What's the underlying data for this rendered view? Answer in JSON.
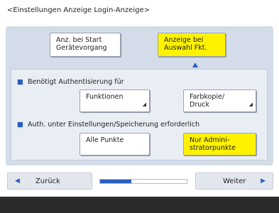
{
  "header": {
    "title": "<Einstellungen Anzeige Login-Anzeige>"
  },
  "mode_buttons": {
    "start": {
      "line1": "Anz. bei Start",
      "line2": "Gerätevorgang"
    },
    "select": {
      "line1": "Anzeige bei",
      "line2": "Auswahl Fkt."
    }
  },
  "auth_section": {
    "label": "Benötigt Authentisierung für",
    "functions": {
      "line1": "Funktionen"
    },
    "colorcopy": {
      "line1": "Farbkopie/",
      "line2": "Druck"
    }
  },
  "settings_section": {
    "label": "Auth. unter Einstellungen/Speicherung erforderlich",
    "all": {
      "line1": "Alle Punkte"
    },
    "admin": {
      "line1": "Nur Admini-",
      "line2": "stratorpunkte"
    }
  },
  "nav": {
    "back_label": "Zurück",
    "next_label": "Weiter",
    "progress": 0.36
  },
  "colors": {
    "selected": "#fff200",
    "accent": "#2a5fbf"
  },
  "icons": {
    "back": "left-arrow-icon",
    "next": "right-arrow-icon",
    "submenu": "submenu-triangle-icon",
    "bullet": "bullet-icon",
    "pointer": "up-arrow-icon"
  }
}
